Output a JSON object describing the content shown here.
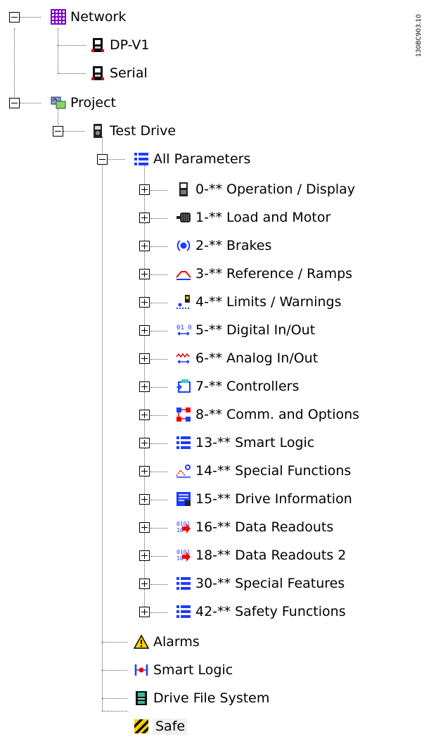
{
  "side_code": "130BC903.10",
  "tree": {
    "network": {
      "label": "Network",
      "children": [
        "DP-V1",
        "Serial"
      ]
    },
    "project": {
      "label": "Project",
      "drive": {
        "label": "Test Drive",
        "all_parameters": {
          "label": "All Parameters",
          "groups": [
            "0-** Operation / Display",
            "1-** Load and Motor",
            "2-** Brakes",
            "3-** Reference / Ramps",
            "4-** Limits / Warnings",
            "5-** Digital In/Out",
            "6-** Analog In/Out",
            "7-** Controllers",
            "8-** Comm. and Options",
            "13-** Smart Logic",
            "14-** Special Functions",
            "15-** Drive Information",
            "16-** Data Readouts",
            "18-** Data Readouts 2",
            "30-** Special Features",
            "42-** Safety Functions"
          ]
        },
        "items": [
          "Alarms",
          "Smart Logic",
          "Drive File System",
          "Safe"
        ]
      }
    }
  }
}
